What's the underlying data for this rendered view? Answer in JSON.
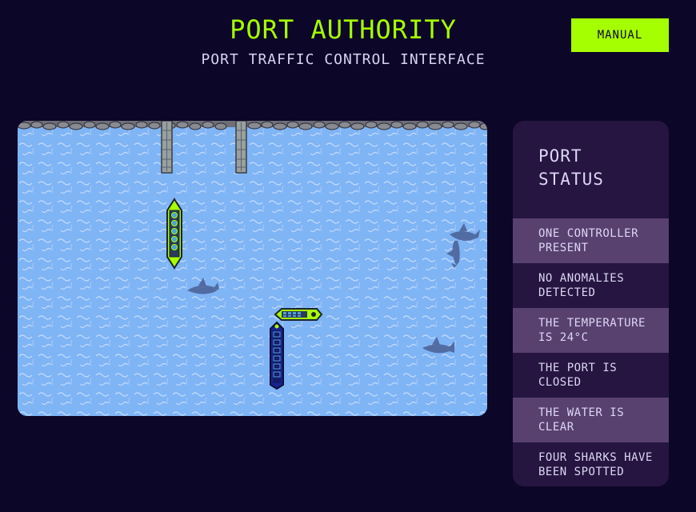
{
  "header": {
    "title": "PORT AUTHORITY",
    "subtitle": "PORT TRAFFIC CONTROL INTERFACE",
    "mode_button_label": "MANUAL"
  },
  "colors": {
    "background": "#0c0628",
    "accent": "#a6ff00",
    "panel": "#251540",
    "panel_highlight": "#58406f",
    "water": "#7fb4f5"
  },
  "map": {
    "docks": 2,
    "ships": [
      {
        "name": "green-cargo-ship",
        "orientation": "vertical"
      },
      {
        "name": "green-tug-ship",
        "orientation": "horizontal"
      },
      {
        "name": "navy-cargo-ship",
        "orientation": "vertical"
      }
    ],
    "sharks": 4
  },
  "status": {
    "title": "PORT\nSTATUS",
    "items": [
      "ONE CONTROLLER PRESENT",
      "NO ANOMALIES DETECTED",
      "THE TEMPERATURE IS 24°C",
      "THE PORT IS CLOSED",
      "THE WATER IS CLEAR",
      "FOUR SHARKS HAVE BEEN SPOTTED"
    ]
  }
}
